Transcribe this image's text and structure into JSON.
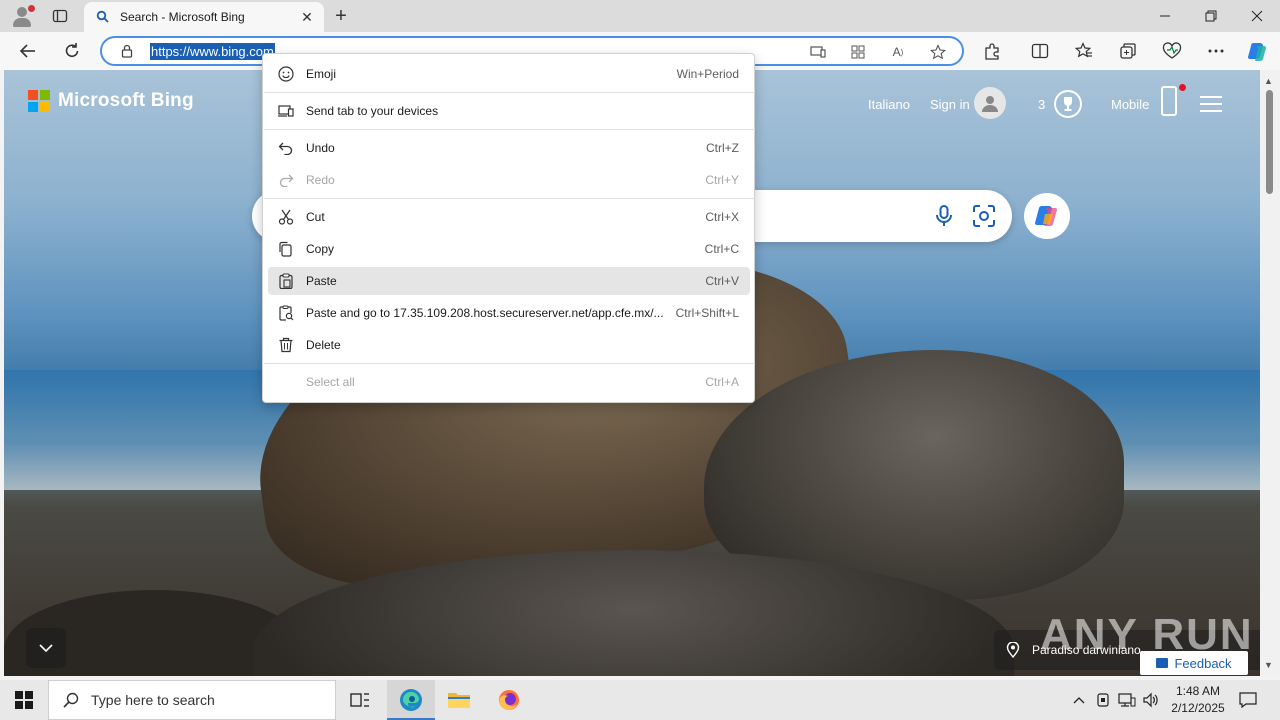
{
  "browser": {
    "tab": {
      "title": "Search - Microsoft Bing"
    },
    "address_url": "https://www.bing.com",
    "window_controls": [
      "minimize",
      "restore",
      "close"
    ]
  },
  "bing": {
    "brand": "Microsoft Bing",
    "language_link": "Italiano",
    "signin_label": "Sign in",
    "rewards_count": "3",
    "mobile_label": "Mobile",
    "location_label": "Paradiso darwiniano",
    "feedback_label": "Feedback",
    "watermark": "ANY RUN"
  },
  "context_menu": {
    "items": [
      {
        "label": "Emoji",
        "shortcut": "Win+Period",
        "icon": "emoji-icon",
        "disabled": false
      },
      {
        "label": "Send tab to your devices",
        "shortcut": "",
        "icon": "devices-icon",
        "disabled": false
      },
      {
        "label": "Undo",
        "shortcut": "Ctrl+Z",
        "icon": "undo-icon",
        "disabled": false
      },
      {
        "label": "Redo",
        "shortcut": "Ctrl+Y",
        "icon": "redo-icon",
        "disabled": true
      },
      {
        "label": "Cut",
        "shortcut": "Ctrl+X",
        "icon": "cut-icon",
        "disabled": false
      },
      {
        "label": "Copy",
        "shortcut": "Ctrl+C",
        "icon": "copy-icon",
        "disabled": false
      },
      {
        "label": "Paste",
        "shortcut": "Ctrl+V",
        "icon": "paste-icon",
        "disabled": false,
        "highlighted": true
      },
      {
        "label": "Paste and go to 17.35.109.208.host.secureserver.net/app.cfe.mx/...",
        "shortcut": "Ctrl+Shift+L",
        "icon": "paste-go-icon",
        "disabled": false
      },
      {
        "label": "Delete",
        "shortcut": "",
        "icon": "delete-icon",
        "disabled": false
      },
      {
        "label": "Select all",
        "shortcut": "Ctrl+A",
        "icon": "",
        "disabled": true
      }
    ]
  },
  "taskbar": {
    "search_placeholder": "Type here to search",
    "time": "1:48 AM",
    "date": "2/12/2025"
  },
  "colors": {
    "accent": "#1a5fb4",
    "address_border": "#4a8fe7",
    "ms_red": "#f25022",
    "ms_green": "#7fba00",
    "ms_blue": "#00a4ef",
    "ms_yellow": "#ffb900"
  }
}
